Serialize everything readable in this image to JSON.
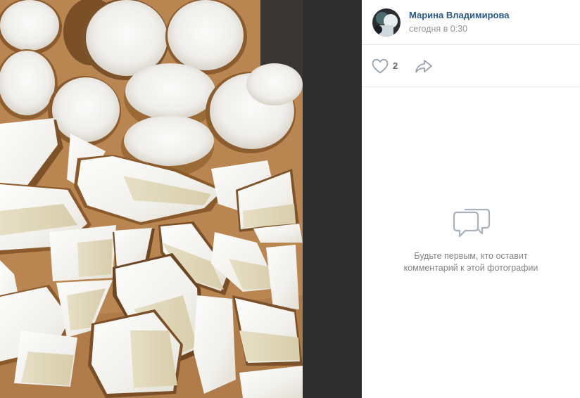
{
  "post": {
    "author_name": "Марина Владимирова",
    "timestamp": "сегодня в 0:30"
  },
  "actions": {
    "like_count": "2",
    "icons": {
      "like": "heart-icon",
      "share": "share-arrow-icon"
    }
  },
  "comments": {
    "empty_message": "Будьте первым, кто оставит комментарий к этой фотографии",
    "icon": "speech-bubbles-icon"
  },
  "colors": {
    "author_link": "#2a5885",
    "muted_text": "#939393",
    "icon_gray": "#99a2ad",
    "divider": "#e7e8ec",
    "gap_dark": "#2d2d2d"
  }
}
